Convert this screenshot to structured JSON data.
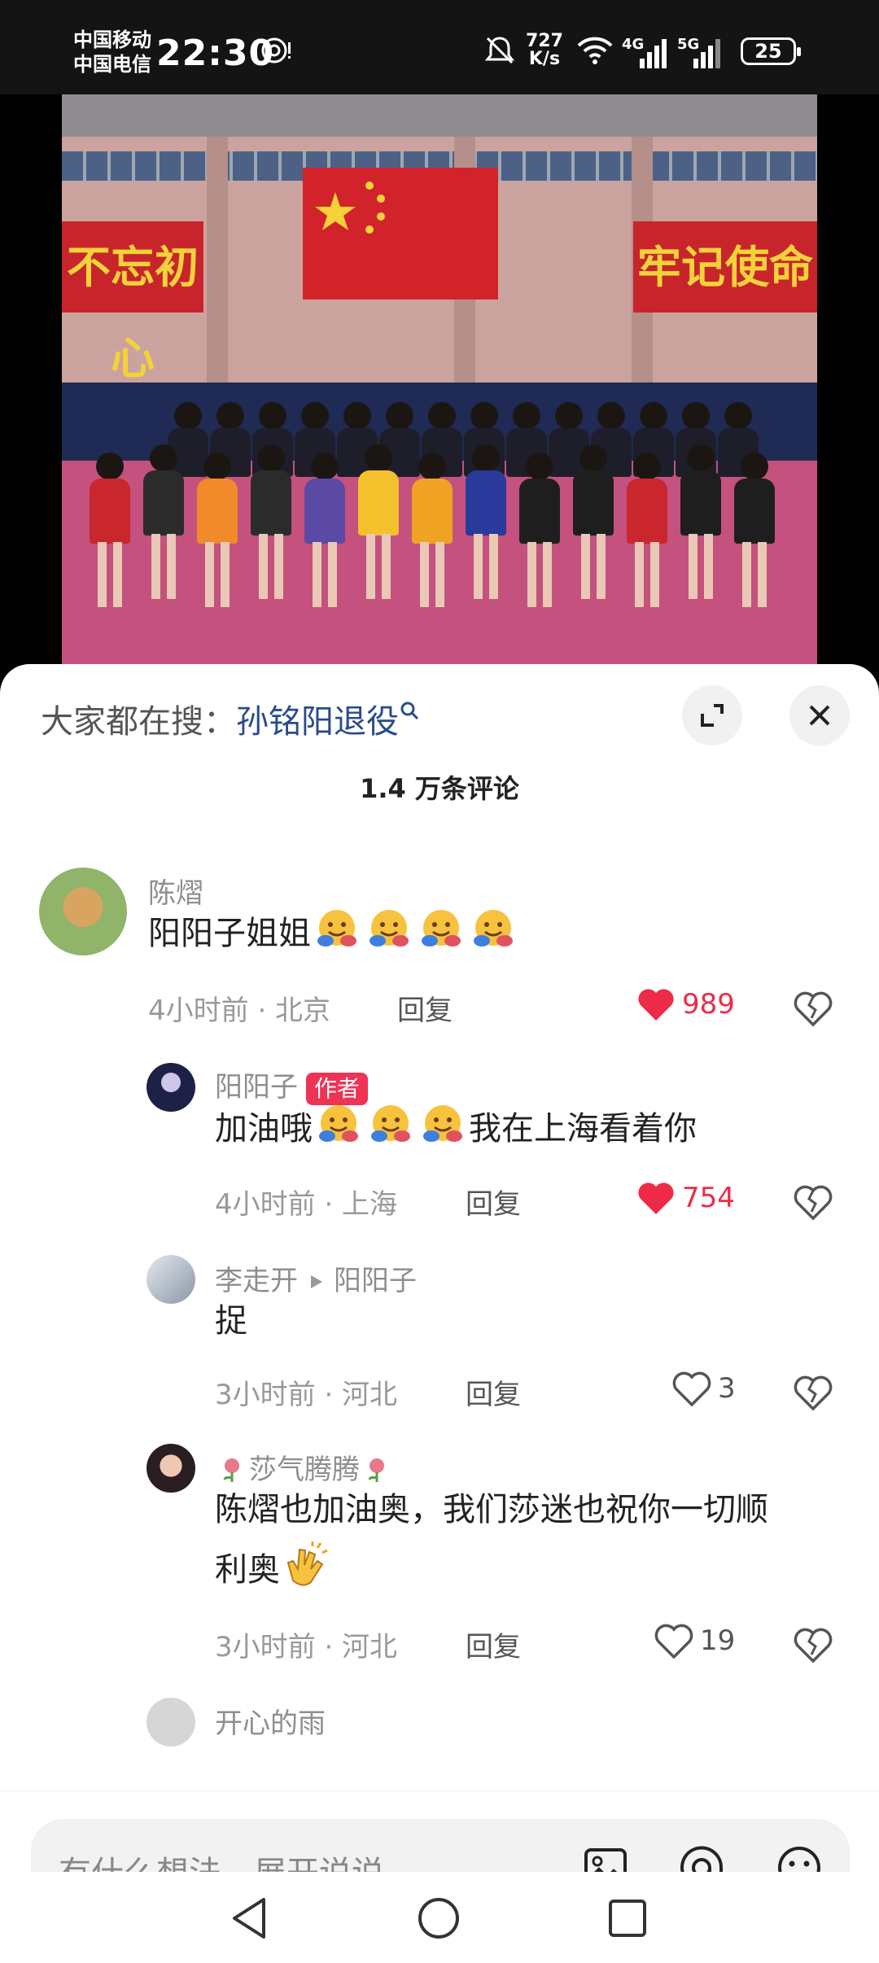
{
  "status_bar": {
    "carrier1": "中国移动",
    "carrier2": "中国电信",
    "time": "22:30",
    "net_speed_value": "727",
    "net_speed_unit": "K/s",
    "gen1": "4G",
    "gen2": "5G",
    "battery": "25"
  },
  "photo": {
    "banner_left": "不忘初心",
    "banner_right": "牢记使命"
  },
  "comments_panel": {
    "hot_search_prefix": "大家都在搜：",
    "hot_search_keyword": "孙铭阳退役",
    "count_label": "1.4 万条评论",
    "comments": [
      {
        "name": "陈熠",
        "text": "阳阳子姐姐",
        "time_loc": "4小时前 · 北京",
        "reply": "回复",
        "likes": "989"
      },
      {
        "name": "阳阳子",
        "badge": "作者",
        "text_a": "加油哦",
        "text_b": "我在上海看着你",
        "time_loc": "4小时前 · 上海",
        "reply": "回复",
        "likes": "754"
      },
      {
        "name": "李走开",
        "reply_to": "阳阳子",
        "text": "捉",
        "time_loc": "3小时前 · 河北",
        "reply": "回复",
        "likes": "3"
      },
      {
        "name": "莎气腾腾",
        "text_line1": "陈熠也加油奥，我们莎迷也祝你一切顺",
        "text_line2": "利奥",
        "time_loc": "3小时前 · 河北",
        "reply": "回复",
        "likes": "19"
      },
      {
        "name": "开心的雨"
      }
    ]
  },
  "input_bar": {
    "placeholder": "有什么想法，展开说说"
  },
  "colors": {
    "like_red": "#ee2b47",
    "badge_red": "#ee3355",
    "keyword_blue": "#2a4b8c"
  },
  "icons": [
    "search-icon",
    "expand-icon",
    "close-icon",
    "heart-icon",
    "broken-heart-icon",
    "image-icon",
    "at-icon",
    "emoji-icon",
    "back-icon",
    "home-icon",
    "recents-icon"
  ]
}
